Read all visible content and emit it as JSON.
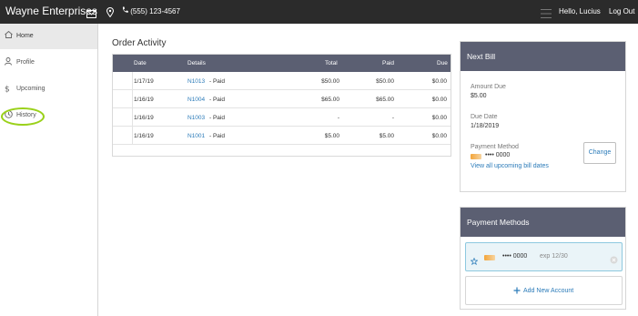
{
  "topbar": {
    "brand": "Wayne Enterprises",
    "phone": "(555) 123-4567",
    "greeting": "Hello, Lucius",
    "logout": "Log Out"
  },
  "sidebar": {
    "items": [
      {
        "label": "Home",
        "icon": "home-icon",
        "active": true
      },
      {
        "label": "Profile",
        "icon": "user-icon",
        "active": false
      },
      {
        "label": "Upcoming",
        "icon": "dollar-icon",
        "active": false
      },
      {
        "label": "History",
        "icon": "clock-icon",
        "active": false
      }
    ],
    "highlight_color": "#9ad11a"
  },
  "main": {
    "title": "Order Activity",
    "columns": [
      "Date",
      "Details",
      "Total",
      "Paid",
      "Due"
    ],
    "rows": [
      {
        "date": "1/17/19",
        "order": "N1013",
        "status": "- Paid",
        "total": "$50.00",
        "paid": "$50.00",
        "due": "$0.00"
      },
      {
        "date": "1/16/19",
        "order": "N1004",
        "status": "- Paid",
        "total": "$65.00",
        "paid": "$65.00",
        "due": "$0.00"
      },
      {
        "date": "1/16/19",
        "order": "N1003",
        "status": "- Paid",
        "total": "-",
        "paid": "-",
        "due": "$0.00"
      },
      {
        "date": "1/16/19",
        "order": "N1001",
        "status": "- Paid",
        "total": "$5.00",
        "paid": "$5.00",
        "due": "$0.00"
      }
    ]
  },
  "next_bill": {
    "title": "Next Bill",
    "amount_label": "Amount Due",
    "amount": "$5.00",
    "due_label": "Due Date",
    "due_date": "1/18/2019",
    "method_label": "Payment Method",
    "card_masked": "•••• 0000",
    "change_label": "Change",
    "view_all_link": "View all upcoming bill dates"
  },
  "payment_methods": {
    "title": "Payment Methods",
    "card_masked": "•••• 0000",
    "expiry": "exp 12/30",
    "add_label": "Add New Account"
  },
  "colors": {
    "header_bg": "#2b2b2b",
    "table_header": "#5b5f72",
    "link": "#2b7bb9",
    "selected_card_bg": "#eaf4f8"
  }
}
